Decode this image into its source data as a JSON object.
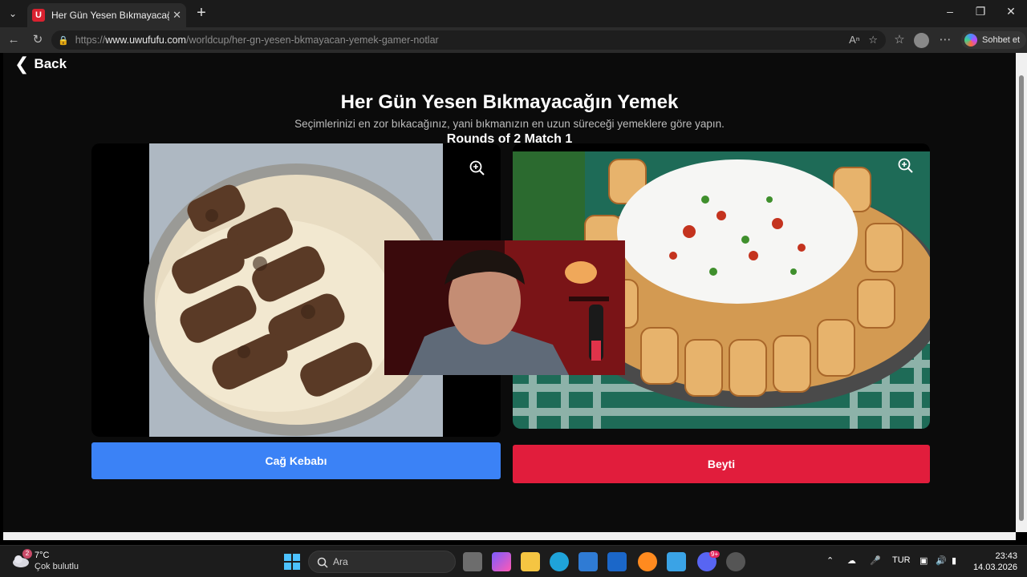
{
  "browser": {
    "tab_title": "Her Gün Yesen Bıkmayacağın Yemek",
    "url_prefix": "https://",
    "url_host": "www.uwufufu.com",
    "url_path": "/worldcup/her-gn-yesen-bkmayacan-yemek-gamer-notlar",
    "favicon_letter": "U",
    "chat_button": "Sohbet et"
  },
  "page": {
    "back_label": "Back",
    "title": "Her Gün Yesen Bıkmayacağın Yemek",
    "subtitle": "Seçimlerinizi en zor bıkacağınız, yani bıkmanızın en uzun süreceği yemeklere göre yapın.",
    "rounds": "Rounds of 2 Match 1",
    "left_choice": "Cağ Kebabı",
    "right_choice": "Beyti",
    "left_color": "#3b82f6",
    "right_color": "#e11d3c"
  },
  "taskbar": {
    "weather_temp": "7°C",
    "weather_condition": "Çok bulutlu",
    "weather_badge": "2",
    "search_placeholder": "Ara",
    "language": "TUR",
    "time": "23:43",
    "date": "14.03.2026",
    "discord_badge": "9+"
  }
}
